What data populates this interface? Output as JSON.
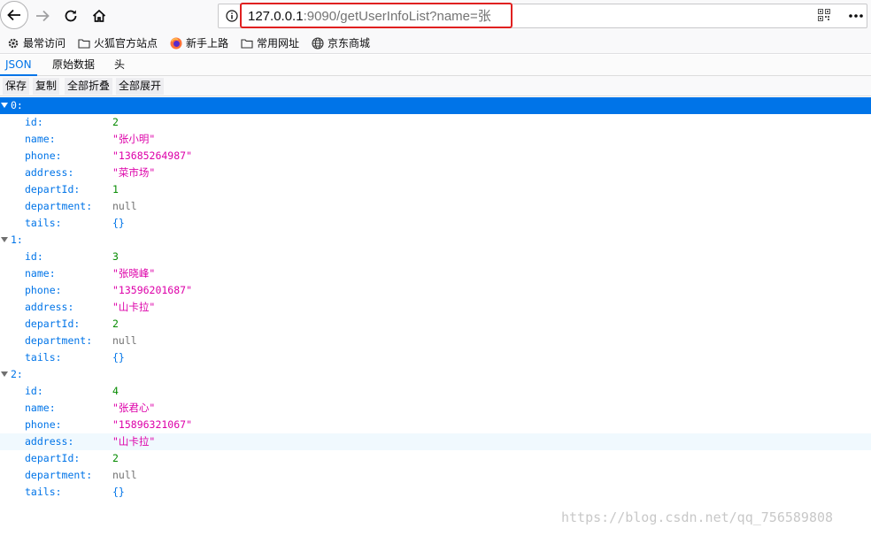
{
  "browser": {
    "url_host": "127.0.0.1",
    "url_rest": ":9090/getUserInfoList?name=张",
    "bookmarks": [
      "最常访问",
      "火狐官方站点",
      "新手上路",
      "常用网址",
      "京东商城"
    ]
  },
  "viewer": {
    "tabs": [
      "JSON",
      "原始数据",
      "头"
    ],
    "toolbar": [
      "保存",
      "复制",
      "全部折叠",
      "全部展开"
    ]
  },
  "records": [
    {
      "index": "0:",
      "fields": [
        {
          "key": "id:",
          "value": "2",
          "type": "num"
        },
        {
          "key": "name:",
          "value": "\"张小明\"",
          "type": "str"
        },
        {
          "key": "phone:",
          "value": "\"13685264987\"",
          "type": "str"
        },
        {
          "key": "address:",
          "value": "\"菜市场\"",
          "type": "str"
        },
        {
          "key": "departId:",
          "value": "1",
          "type": "num"
        },
        {
          "key": "department:",
          "value": "null",
          "type": "null"
        },
        {
          "key": "tails:",
          "value": "{}",
          "type": "obj"
        }
      ]
    },
    {
      "index": "1:",
      "fields": [
        {
          "key": "id:",
          "value": "3",
          "type": "num"
        },
        {
          "key": "name:",
          "value": "\"张晓峰\"",
          "type": "str"
        },
        {
          "key": "phone:",
          "value": "\"13596201687\"",
          "type": "str"
        },
        {
          "key": "address:",
          "value": "\"山卡拉\"",
          "type": "str"
        },
        {
          "key": "departId:",
          "value": "2",
          "type": "num"
        },
        {
          "key": "department:",
          "value": "null",
          "type": "null"
        },
        {
          "key": "tails:",
          "value": "{}",
          "type": "obj"
        }
      ]
    },
    {
      "index": "2:",
      "fields": [
        {
          "key": "id:",
          "value": "4",
          "type": "num"
        },
        {
          "key": "name:",
          "value": "\"张君心\"",
          "type": "str"
        },
        {
          "key": "phone:",
          "value": "\"15896321067\"",
          "type": "str"
        },
        {
          "key": "address:",
          "value": "\"山卡拉\"",
          "type": "str"
        },
        {
          "key": "departId:",
          "value": "2",
          "type": "num"
        },
        {
          "key": "department:",
          "value": "null",
          "type": "null"
        },
        {
          "key": "tails:",
          "value": "{}",
          "type": "obj"
        }
      ]
    }
  ],
  "watermark": "https://blog.csdn.net/qq_756589808",
  "colors": {
    "accent": "#0074e8",
    "number": "#058b00",
    "string": "#dd00a9",
    "null": "#737373",
    "url_highlight": "#e02020"
  }
}
